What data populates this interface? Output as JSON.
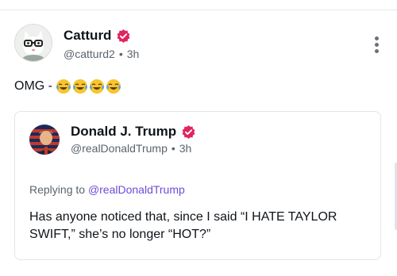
{
  "post": {
    "author_name": "Catturd",
    "handle": "@catturd2",
    "separator": "•",
    "time": "3h",
    "text": "OMG -",
    "emoji": [
      "face-with-tears-of-joy",
      "face-with-tears-of-joy",
      "face-with-tears-of-joy",
      "face-with-tears-of-joy"
    ],
    "verified_icon": "verified-badge-icon",
    "more_icon": "more-vertical-icon"
  },
  "quote": {
    "author_name": "Donald J. Trump",
    "handle": "@realDonaldTrump",
    "separator": "•",
    "time": "3h",
    "replying_prefix": "Replying to",
    "replying_to": "@realDonaldTrump",
    "text": "Has anyone noticed that, since I said “I HATE TAYLOR SWIFT,” she’s no longer “HOT?”"
  },
  "colors": {
    "verified": "#e0245e",
    "link": "#6d4bd9",
    "muted": "#5b636b",
    "border": "#e3e5e8"
  }
}
